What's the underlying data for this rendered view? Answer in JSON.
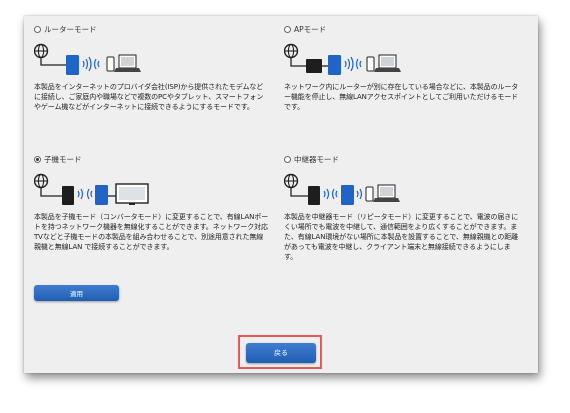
{
  "modes": [
    {
      "id": "router",
      "title": "ルーターモード",
      "selected": false,
      "diagram": [
        "globe-icon",
        "router-device-icon",
        "wifi-waves-icon",
        "smartphone-icon",
        "laptop-icon"
      ],
      "description": "本製品をインターネットのプロバイダ会社(ISP)から提供されたモデムなどに接続し、ご家庭内や職場などで複数のPCやタブレット、スマートフォンやゲーム機などがインターネットに接続できるようにするモードです。"
    },
    {
      "id": "ap",
      "title": "APモード",
      "selected": false,
      "diagram": [
        "globe-icon",
        "existing-router-icon",
        "router-device-icon",
        "wifi-waves-icon",
        "smartphone-icon",
        "laptop-icon"
      ],
      "description": "ネットワーク内にルーターが別に存在している場合などに、本製品のルーター機能を停止し、無線LANアクセスポイントとしてご利用いただけるモードです。"
    },
    {
      "id": "child",
      "title": "子機モード",
      "selected": true,
      "diagram": [
        "globe-icon",
        "existing-router-icon",
        "wifi-waves-icon",
        "router-device-icon",
        "tv-icon"
      ],
      "description": "本製品を子機モード（コンバータモード）に変更することで、有線LANポートを持つネットワーク機器を無線化することができます。ネットワーク対応TVなどと子機モードの本製品を組み合わせることで、別途用意された無線親機と無線LAN で接続することができます。"
    },
    {
      "id": "repeater",
      "title": "中継器モード",
      "selected": false,
      "diagram": [
        "globe-icon",
        "existing-router-icon",
        "wifi-waves-icon",
        "router-device-icon",
        "smartphone-icon",
        "laptop-icon"
      ],
      "description": "本製品を中継器モード（リピータモード）に変更することで、電波の届きにくい場所でも電波を中継して、通信範囲をより広くすることができます。また、有線LAN環境がない場所に本製品を設置することで、無線親機との距離があっても電波を中継し、クライアント端末と無線接続できるようにします。"
    }
  ],
  "buttons": {
    "apply": "適用",
    "back": "戻る"
  },
  "colors": {
    "button": "#2f6fc4",
    "device_blue": "#1f64c6",
    "device_black": "#1e1e1e",
    "highlight": "#e85a5a",
    "panel_bg": "#efefef"
  }
}
